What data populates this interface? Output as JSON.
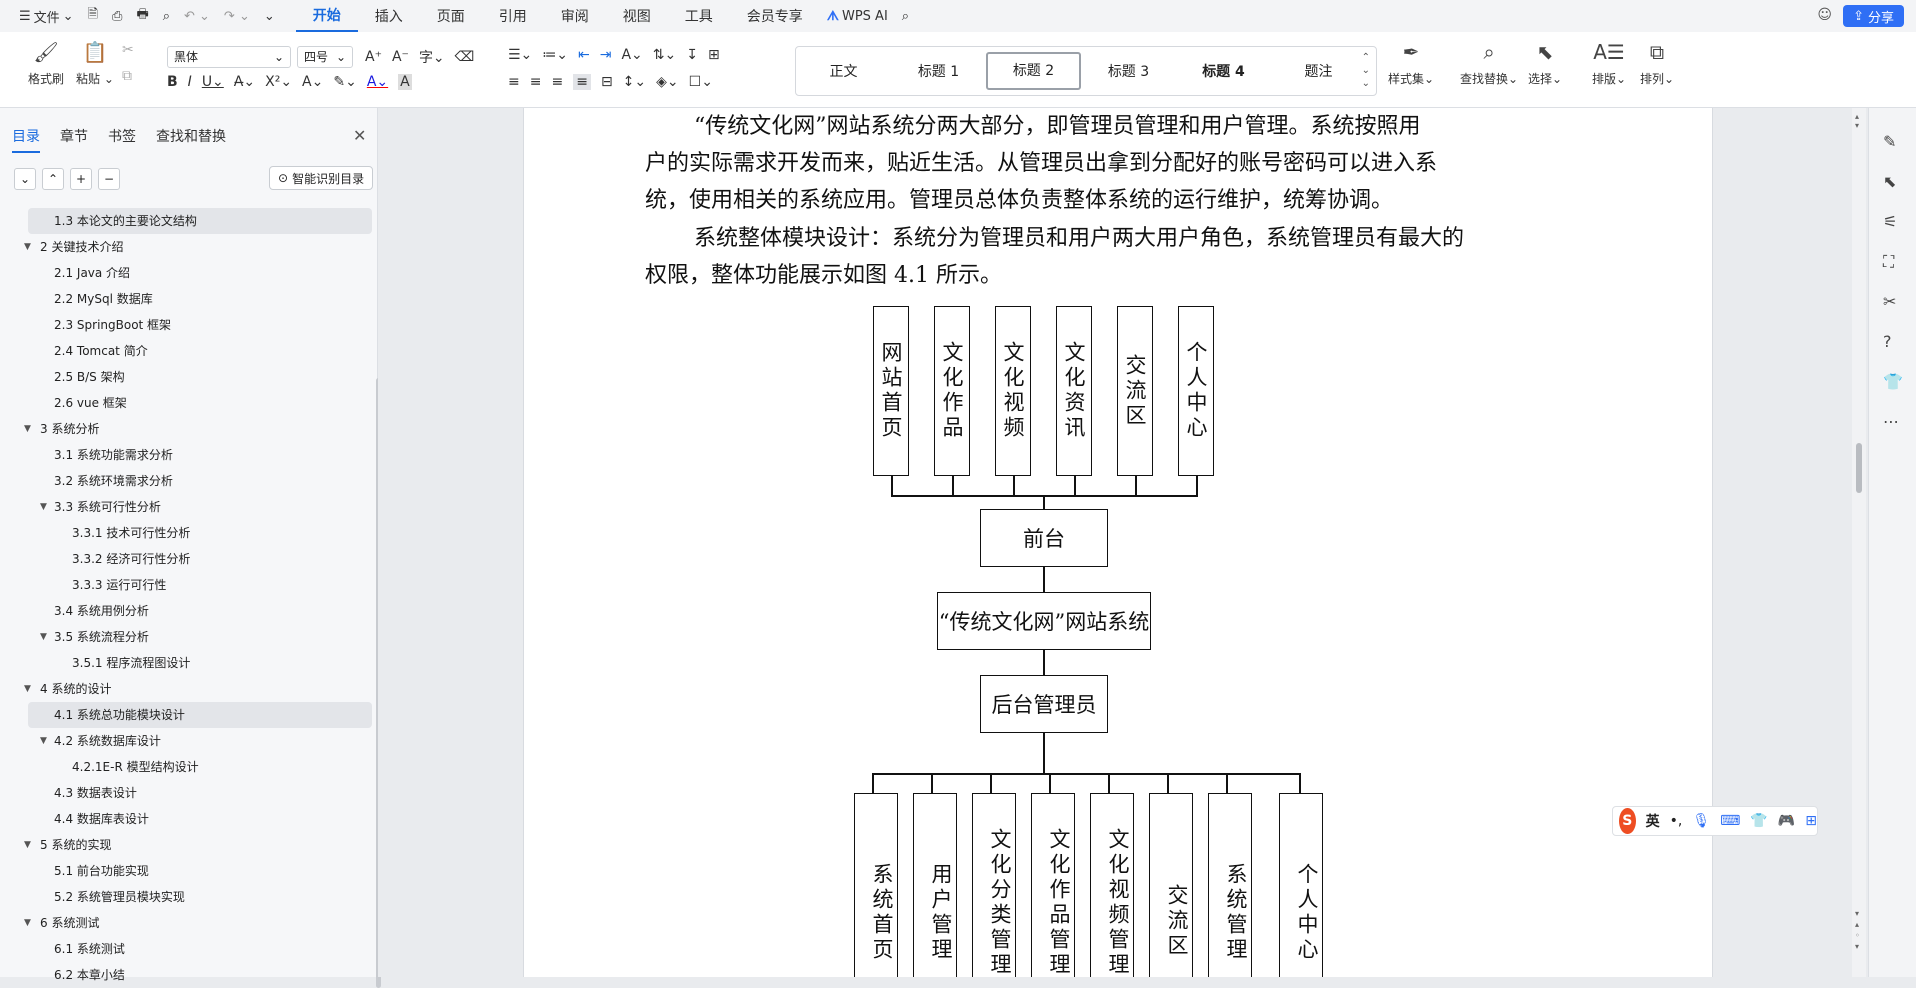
{
  "titlebar": {
    "file_menu": "文件",
    "menu_tabs": [
      "开始",
      "插入",
      "页面",
      "引用",
      "审阅",
      "视图",
      "工具",
      "会员专享"
    ],
    "wps_ai": "WPS AI",
    "share": "分享"
  },
  "ribbon": {
    "format_painter": "格式刷",
    "paste": "粘贴",
    "font_name": "黑体",
    "font_size": "四号",
    "styles": [
      "正文",
      "标题 1",
      "标题 2",
      "标题 3",
      "标题 4",
      "题注"
    ],
    "selected_style": "标题 2",
    "style_set": "样式集",
    "find_replace": "查找替换",
    "select": "选择",
    "layout": "排版",
    "arrange": "排列"
  },
  "sidebar": {
    "tabs": [
      "目录",
      "章节",
      "书签",
      "查找和替换"
    ],
    "smart_toc": "智能识别目录",
    "items": [
      {
        "label": "1.3 本论文的主要论文结构",
        "level": 2,
        "highlight": true
      },
      {
        "label": "2 关键技术介绍",
        "level": 1,
        "expanded": true
      },
      {
        "label": "2.1 Java 介绍",
        "level": 2
      },
      {
        "label": "2.2 MySql 数据库",
        "level": 2
      },
      {
        "label": "2.3 SpringBoot 框架",
        "level": 2
      },
      {
        "label": "2.4 Tomcat 简介",
        "level": 2
      },
      {
        "label": "2.5 B/S 架构",
        "level": 2
      },
      {
        "label": "2.6 vue 框架",
        "level": 2
      },
      {
        "label": "3 系统分析",
        "level": 1,
        "expanded": true
      },
      {
        "label": "3.1 系统功能需求分析",
        "level": 2
      },
      {
        "label": "3.2 系统环境需求分析",
        "level": 2
      },
      {
        "label": "3.3 系统可行性分析",
        "level": 2,
        "expanded": true
      },
      {
        "label": "3.3.1 技术可行性分析",
        "level": 3
      },
      {
        "label": "3.3.2 经济可行性分析",
        "level": 3
      },
      {
        "label": "3.3.3 运行可行性",
        "level": 3
      },
      {
        "label": "3.4 系统用例分析",
        "level": 2
      },
      {
        "label": "3.5 系统流程分析",
        "level": 2,
        "expanded": true
      },
      {
        "label": "3.5.1 程序流程图设计",
        "level": 3
      },
      {
        "label": "4 系统的设计",
        "level": 1,
        "expanded": true
      },
      {
        "label": "4.1 系统总功能模块设计",
        "level": 2,
        "highlight": true
      },
      {
        "label": "4.2 系统数据库设计",
        "level": 2,
        "expanded": true
      },
      {
        "label": "4.2.1E-R 模型结构设计",
        "level": 3
      },
      {
        "label": "4.3 数据表设计",
        "level": 2
      },
      {
        "label": "4.4 数据库表设计",
        "level": 2
      },
      {
        "label": "5 系统的实现",
        "level": 1,
        "expanded": true
      },
      {
        "label": "5.1 前台功能实现",
        "level": 2
      },
      {
        "label": "5.2 系统管理员模块实现",
        "level": 2
      },
      {
        "label": "6 系统测试",
        "level": 1,
        "expanded": true
      },
      {
        "label": "6.1 系统测试",
        "level": 2
      },
      {
        "label": "6.2 本章小结",
        "level": 2
      }
    ]
  },
  "document": {
    "lines": [
      "“传统文化网”网站系统分两大部分，即管理员管理和用户管理。系统按照用",
      "户的实际需求开发而来，贴近生活。从管理员出拿到分配好的账号密码可以进入系",
      "统，使用相关的系统应用。管理员总体负责整体系统的运行维护，统筹协调。",
      "系统整体模块设计：系统分为管理员和用户两大用户角色，系统管理员有最大的",
      "权限，整体功能展示如图 4.1 所示。"
    ],
    "diagram": {
      "front_modules": [
        "网站首页",
        "文化作品",
        "文化视频",
        "文化资讯",
        "交流区",
        "个人中心"
      ],
      "front": "前台",
      "system": "“传统文化网”网站系统",
      "admin": "后台管理员",
      "admin_modules": [
        "系统首页",
        "用户管理",
        "文化分类管理",
        "文化作品管理",
        "文化视频管理",
        "交流区",
        "系统管理",
        "个人中心"
      ]
    }
  },
  "ime": {
    "label": "英"
  }
}
